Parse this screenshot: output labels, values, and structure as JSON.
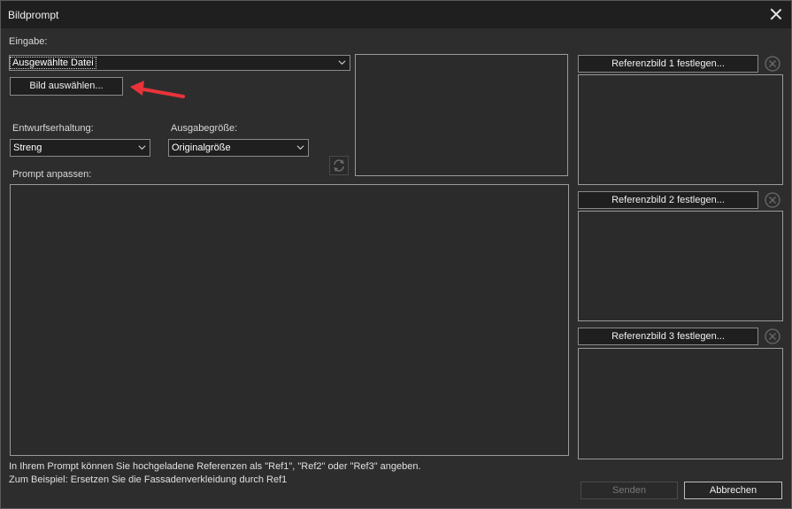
{
  "window": {
    "title": "Bildprompt"
  },
  "input": {
    "label": "Eingabe:",
    "source_value": "Ausgewählte Datei",
    "choose_image_label": "Bild auswählen..."
  },
  "draft_preservation": {
    "label": "Entwurfserhaltung:",
    "value": "Streng"
  },
  "output_size": {
    "label": "Ausgabegröße:",
    "value": "Originalgröße"
  },
  "prompt": {
    "label": "Prompt anpassen:",
    "value": ""
  },
  "references": [
    {
      "button_label": "Referenzbild 1 festlegen..."
    },
    {
      "button_label": "Referenzbild 2 festlegen..."
    },
    {
      "button_label": "Referenzbild 3 festlegen..."
    }
  ],
  "notes": {
    "line1": "In Ihrem Prompt können Sie hochgeladene Referenzen als \"Ref1\", \"Ref2\" oder \"Ref3\" angeben.",
    "line2": "Zum Beispiel: Ersetzen Sie die Fassadenverkleidung durch Ref1"
  },
  "footer": {
    "send_label": "Senden",
    "cancel_label": "Abbrechen"
  },
  "icons": {
    "close": "close-icon",
    "dropdown": "chevron-down-icon",
    "refresh": "refresh-icon",
    "clear": "clear-circle-x-icon",
    "annotation": "red-arrow-icon"
  },
  "colors": {
    "accent_arrow": "#e8333a",
    "background": "#2d2d2d",
    "titlebar": "#1f1f1f"
  }
}
